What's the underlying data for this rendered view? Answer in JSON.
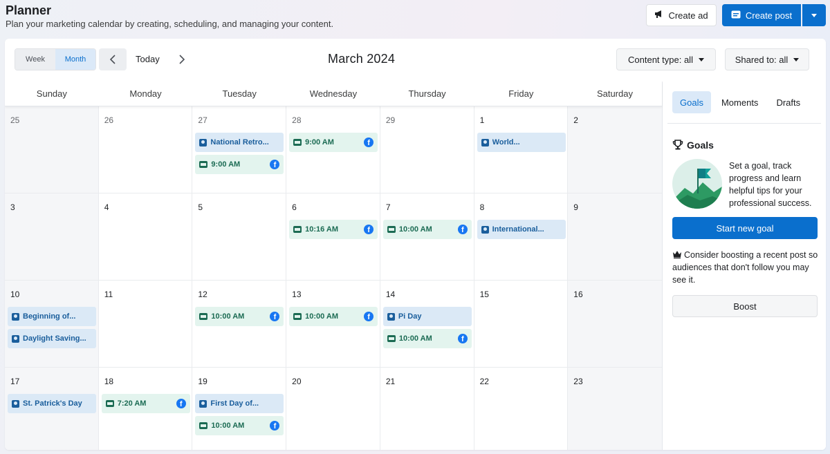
{
  "header": {
    "title": "Planner",
    "subtitle": "Plan your marketing calendar by creating, scheduling, and managing your content."
  },
  "actions": {
    "create_ad": "Create ad",
    "create_post": "Create post"
  },
  "toolbar": {
    "view_week": "Week",
    "view_month": "Month",
    "today": "Today",
    "month_title": "March 2024",
    "content_type": "Content type: all",
    "shared_to": "Shared to: all"
  },
  "weekdays": [
    "Sunday",
    "Monday",
    "Tuesday",
    "Wednesday",
    "Thursday",
    "Friday",
    "Saturday"
  ],
  "days": [
    {
      "n": "25",
      "muted": true,
      "events": []
    },
    {
      "n": "26",
      "muted": true,
      "events": []
    },
    {
      "n": "27",
      "muted": true,
      "events": [
        {
          "kind": "moment",
          "label": "National Retro..."
        },
        {
          "kind": "post",
          "label": "9:00 AM",
          "fb": true
        }
      ]
    },
    {
      "n": "28",
      "muted": true,
      "events": [
        {
          "kind": "post",
          "label": "9:00 AM",
          "fb": true
        }
      ]
    },
    {
      "n": "29",
      "muted": true,
      "events": []
    },
    {
      "n": "1",
      "events": [
        {
          "kind": "moment",
          "label": "World..."
        }
      ]
    },
    {
      "n": "2",
      "events": []
    },
    {
      "n": "3",
      "events": []
    },
    {
      "n": "4",
      "events": []
    },
    {
      "n": "5",
      "events": []
    },
    {
      "n": "6",
      "events": [
        {
          "kind": "post",
          "label": "10:16 AM",
          "fb": true
        }
      ]
    },
    {
      "n": "7",
      "events": [
        {
          "kind": "post",
          "label": "10:00 AM",
          "fb": true
        }
      ]
    },
    {
      "n": "8",
      "events": [
        {
          "kind": "moment",
          "label": "International..."
        }
      ]
    },
    {
      "n": "9",
      "events": []
    },
    {
      "n": "10",
      "events": [
        {
          "kind": "moment",
          "label": "Beginning of..."
        },
        {
          "kind": "moment",
          "label": "Daylight Saving..."
        }
      ]
    },
    {
      "n": "11",
      "events": []
    },
    {
      "n": "12",
      "events": [
        {
          "kind": "post",
          "label": "10:00 AM",
          "fb": true
        }
      ]
    },
    {
      "n": "13",
      "events": [
        {
          "kind": "post",
          "label": "10:00 AM",
          "fb": true
        }
      ]
    },
    {
      "n": "14",
      "events": [
        {
          "kind": "moment",
          "label": "Pi Day"
        },
        {
          "kind": "post",
          "label": "10:00 AM",
          "fb": true
        }
      ]
    },
    {
      "n": "15",
      "events": []
    },
    {
      "n": "16",
      "events": []
    },
    {
      "n": "17",
      "events": [
        {
          "kind": "moment",
          "label": "St. Patrick's Day"
        }
      ]
    },
    {
      "n": "18",
      "events": [
        {
          "kind": "post",
          "label": "7:20 AM",
          "fb": true
        }
      ]
    },
    {
      "n": "19",
      "events": [
        {
          "kind": "moment",
          "label": "First Day of..."
        },
        {
          "kind": "post",
          "label": "10:00 AM",
          "fb": true
        }
      ]
    },
    {
      "n": "20",
      "events": []
    },
    {
      "n": "21",
      "events": []
    },
    {
      "n": "22",
      "events": []
    },
    {
      "n": "23",
      "events": []
    }
  ],
  "sidebar": {
    "tabs": [
      "Goals",
      "Moments",
      "Drafts"
    ],
    "goals_title": "Goals",
    "goals_text": "Set a goal, track progress and learn helpful tips for your professional success.",
    "start_goal": "Start new goal",
    "boost_tip": "Consider boosting a recent post so audiences that don't follow you may see it.",
    "boost": "Boost"
  },
  "colors": {
    "accent": "#0a6fcd",
    "moment_bg": "#dbe9f6",
    "post_bg": "#e3f4ee",
    "facebook": "#1877f2"
  }
}
